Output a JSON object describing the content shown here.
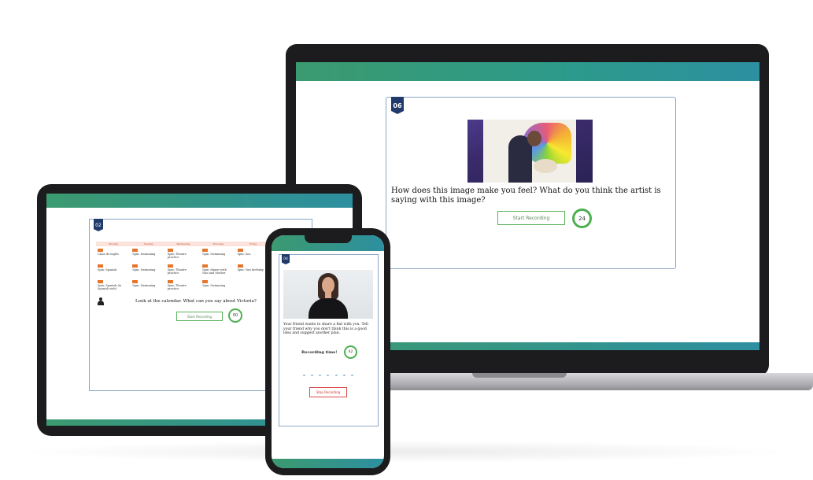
{
  "laptop": {
    "badge": "06",
    "question": "How does this image make you feel? What do you think the artist is saying with this image?",
    "button_label": "Start Recording",
    "timer": "24",
    "icon": "painting-image"
  },
  "tablet": {
    "badge": "02",
    "calendar_headers": [
      "Monday",
      "Tuesday",
      "Wednesday",
      "Thursday",
      "Friday"
    ],
    "calendar_events": [
      "Clase de inglés",
      "Spm: Swimming",
      "Spm: Theatre practice",
      "Spm: Swimming",
      "Spm: Zoo",
      "Spm: Spanish",
      "Spm: Swimming",
      "Spm: Theatre practice",
      "Spm: dinner with Nan and Mother",
      "Spm: Yuri birthday",
      "Spm: Spanish (in Spanish web)",
      "Spm: Swimming",
      "Spm: Theatre practice",
      "Spm: Swimming",
      ""
    ],
    "question": "Look at the calendar. What can you say about Victoria?",
    "button_label": "Start Recording",
    "timer": "00"
  },
  "phone": {
    "badge": "04",
    "prompt": "Your friend wants to share a flat with you. Tell your friend why you don't think this is a good idea and suggest another plan.",
    "recording_label": "Recording time!",
    "timer": "42",
    "stop_label": "Stop Recording"
  }
}
